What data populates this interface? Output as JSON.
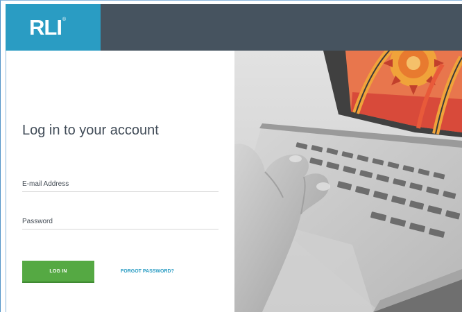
{
  "header": {
    "logo_text": "RLI",
    "logo_mark": "®",
    "colors": {
      "bar": "#46535f",
      "logo_bg": "#2a9cc3"
    }
  },
  "login": {
    "title": "Log in to your account",
    "email_label": "E-mail Address",
    "password_label": "Password",
    "login_button": "LOG IN",
    "forgot_link": "FORGOT PASSWORD?",
    "colors": {
      "button": "#55a943",
      "link": "#2a9cc3"
    }
  },
  "hero_image": {
    "description_icon": "laptop-hand-photo"
  }
}
